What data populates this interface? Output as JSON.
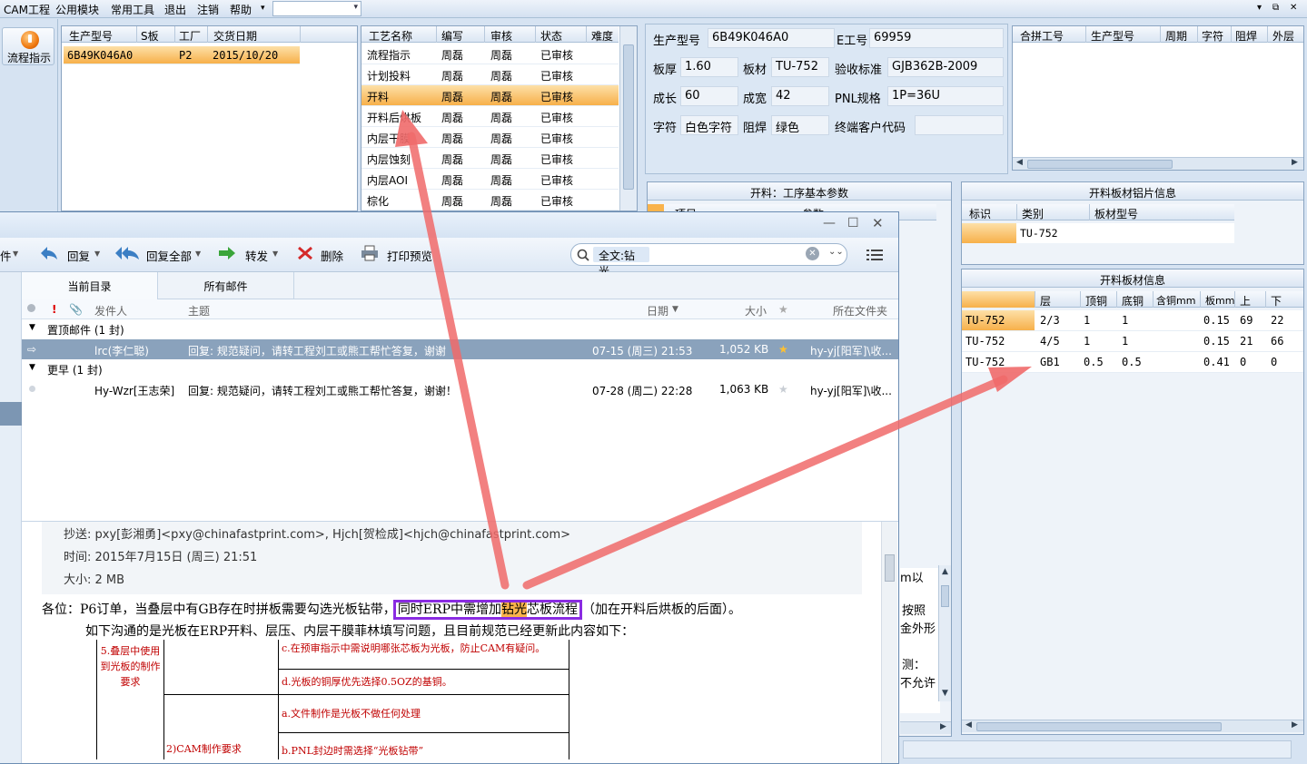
{
  "menu": {
    "items": [
      "CAM工程",
      "公用模块",
      "常用工具",
      "退出",
      "注销",
      "帮助"
    ],
    "dropdown_arrow": "▾",
    "window_controls": [
      "▾",
      "⧉",
      "✕"
    ]
  },
  "flow_button": {
    "label": "流程指示",
    "icon": "power-orb-icon"
  },
  "orders": {
    "headers": [
      "生产型号",
      "S板",
      "工厂",
      "交货日期"
    ],
    "rows": [
      {
        "model": "6B49K046A0",
        "s": "",
        "factory": "P2",
        "date": "2015/10/20"
      }
    ]
  },
  "process": {
    "headers": [
      "工艺名称",
      "编写",
      "审核",
      "状态",
      "难度"
    ],
    "rows": [
      {
        "name": "流程指示",
        "writer": "周磊",
        "reviewer": "周磊",
        "status": "已审核"
      },
      {
        "name": "计划投料",
        "writer": "周磊",
        "reviewer": "周磊",
        "status": "已审核"
      },
      {
        "name": "开料",
        "writer": "周磊",
        "reviewer": "周磊",
        "status": "已审核"
      },
      {
        "name": "开料后烘板",
        "writer": "周磊",
        "reviewer": "周磊",
        "status": "已审核"
      },
      {
        "name": "内层干膜",
        "writer": "周磊",
        "reviewer": "周磊",
        "status": "已审核"
      },
      {
        "name": "内层蚀刻",
        "writer": "周磊",
        "reviewer": "周磊",
        "status": "已审核"
      },
      {
        "name": "内层AOI",
        "writer": "周磊",
        "reviewer": "周磊",
        "status": "已审核"
      },
      {
        "name": "棕化",
        "writer": "周磊",
        "reviewer": "周磊",
        "status": "已审核"
      }
    ]
  },
  "info": {
    "model_label": "生产型号",
    "model": "6B49K046A0",
    "eno_label": "E工号",
    "eno": "69959",
    "thick_label": "板厚",
    "thick": "1.60",
    "material_label": "板材",
    "material": "TU-752",
    "std_label": "验收标准",
    "std": "GJB362B-2009",
    "len_label": "成长",
    "len": "60",
    "width_label": "成宽",
    "width": "42",
    "pnl_label": "PNL规格",
    "pnl": "1P=36U",
    "char_label": "字符",
    "char": "白色字符",
    "mask_label": "阻焊",
    "mask": "绿色",
    "cust_label": "终端客户代码",
    "cust": ""
  },
  "combine": {
    "headers": [
      "合拼工号",
      "生产型号",
      "周期",
      "字符",
      "阻焊",
      "外层"
    ]
  },
  "params": {
    "title": "开料：工序基本参数",
    "headers": [
      "项目",
      "参数"
    ],
    "right_text": [
      "m以",
      "按照",
      "金外形",
      "测：",
      "不允许"
    ]
  },
  "foil": {
    "title": "开料板材铝片信息",
    "headers": [
      "标识",
      "类别",
      "板材型号"
    ],
    "rows": [
      {
        "id": "",
        "type": "TU-752",
        "model": ""
      }
    ]
  },
  "board": {
    "title": "开料板材信息",
    "headers": [
      "板材",
      "层",
      "顶铜",
      "底铜",
      "含铜mm",
      "板mm",
      "上",
      "下"
    ],
    "rows": [
      [
        "TU-752",
        "2/3",
        "1",
        "1",
        "",
        "0.15",
        "69",
        "22"
      ],
      [
        "TU-752",
        "4/5",
        "1",
        "1",
        "",
        "0.15",
        "21",
        "66"
      ],
      [
        "TU-752",
        "GB1",
        "0.5",
        "0.5",
        "",
        "0.41",
        "0",
        "0"
      ]
    ]
  },
  "mail": {
    "window_controls": [
      "—",
      "☐",
      "✕"
    ],
    "toolbar": {
      "left_cut": "件",
      "reply": "回复",
      "reply_all": "回复全部",
      "forward": "转发",
      "delete": "删除",
      "print": "打印预览"
    },
    "search_value": "全文:钻光",
    "tabs": [
      "当前目录",
      "所有邮件"
    ],
    "columns": {
      "from": "发件人",
      "subject": "主题",
      "date": "日期",
      "size": "大小",
      "folder": "所在文件夹"
    },
    "groups": [
      {
        "label": "置顶邮件 (1 封)",
        "items": [
          {
            "from": "lrc(李仁聪)",
            "subject": "回复: 规范疑问，请转工程刘工或熊工帮忙答复，谢谢",
            "date": "07-15 (周三) 21:53",
            "size": "1,052 KB",
            "folder": "hy-yj[阳军]\\收..."
          }
        ]
      },
      {
        "label": "更早 (1 封)",
        "items": [
          {
            "from": "Hy-Wzr[王志荣]",
            "subject": "回复: 规范疑问，请转工程刘工或熊工帮忙答复，谢谢！",
            "date": "07-28 (周二) 22:28",
            "size": "1,063 KB",
            "folder": "hy-yj[阳军]\\收..."
          }
        ]
      }
    ],
    "preview": {
      "cc": "抄送: pxy[彭湘勇]<pxy@chinafastprint.com>,  Hjch[贺检成]<hjch@chinafastprint.com>",
      "time": "时间: 2015年7月15日 (周三) 21:51",
      "size": "大小: 2 MB",
      "body_pre": "各位：P6订单，当叠层中有GB存在时拼板需要勾选光板钻带，",
      "body_hl_a": "同时ERP中需增加",
      "body_hl_b": "钻光",
      "body_hl_c": "芯板流程",
      "body_post": "（加在开料后烘板的后面）。",
      "body_line2": "如下沟通的是光板在ERP开料、层压、内层干膜菲林填写问题，且目前规范已经更新此内容如下：",
      "table": {
        "c1": "5.叠层中使用到光板的制作要求",
        "c2": "2)CAM制作要求",
        "r1": "c.在预审指示中需说明哪张芯板为光板，防止CAM有疑问。",
        "r2": "d.光板的铜厚优先选择0.5OZ的基铜。",
        "r3": "a.文件制作是光板不做任何处理",
        "r4": "b.PNL封边时需选择“光板钻带”"
      }
    }
  },
  "colors": {
    "highlight": "#f9b34c",
    "arrow": "#f06a6a",
    "box": "#8a2be2",
    "panel": "#d6e3f2"
  }
}
